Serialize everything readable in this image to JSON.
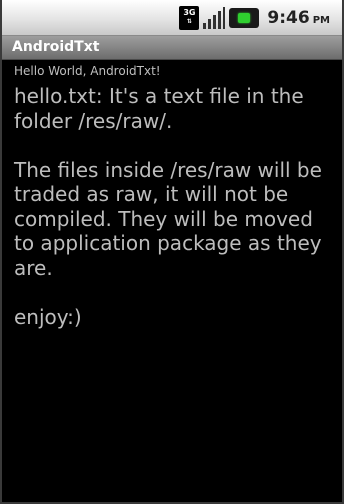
{
  "status_bar": {
    "network_label": "3G",
    "time": "9:46",
    "ampm": "PM",
    "icons": [
      "network-3g-icon",
      "signal-strength-icon",
      "battery-charging-icon"
    ],
    "battery_color": "#2fcf2f"
  },
  "app": {
    "title": "AndroidTxt",
    "hello_text": "Hello World, AndroidTxt!",
    "file_content": "hello.txt: It's a text file in the folder /res/raw/.\n\nThe files inside /res/raw will be traded as raw, it will not be compiled. They will be moved to application package as they are.\n\nenjoy:)"
  },
  "colors": {
    "background": "#000000",
    "title_bar": "#7e7e7e",
    "text": "#bdbdbd"
  }
}
